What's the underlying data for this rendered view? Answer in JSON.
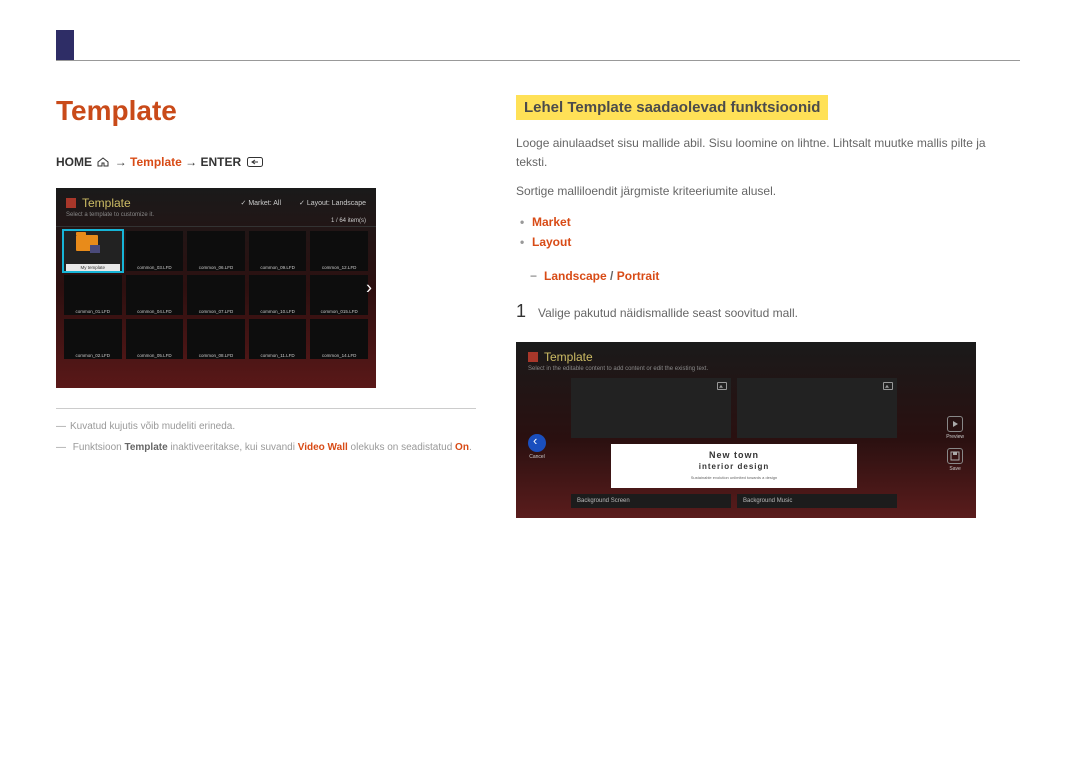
{
  "title": "Template",
  "breadcrumb": {
    "home": "HOME",
    "arrow": "→",
    "template": "Template",
    "enter": "ENTER"
  },
  "screenshot1": {
    "title": "Template",
    "subtitle": "Select a template to customize it.",
    "dropdowns": {
      "market": "Market: All",
      "layout": "Layout: Landscape"
    },
    "count": "1 / 64 item(s)",
    "mytemplate": "My template",
    "items": [
      "",
      "common_03.LFD",
      "common_06.LFD",
      "common_09.LFD",
      "common_12.LFD",
      "common_01.LFD",
      "common_04.LFD",
      "common_07.LFD",
      "common_10.LFD",
      "common_015.LFD",
      "common_02.LFD",
      "common_05.LFD",
      "common_08.LFD",
      "common_11.LFD",
      "common_14.LFD"
    ]
  },
  "notes": {
    "n1_pre": "Kuvatud kujutis võib mudeliti erineda.",
    "n2_a": "Funktsioon",
    "n2_b": "Template",
    "n2_c": "inaktiveeritakse, kui suvandi",
    "n2_d": "Video Wall",
    "n2_e": "olekuks on seadistatud",
    "n2_f": "On",
    "n2_g": "."
  },
  "right": {
    "heading": "Lehel Template saadaolevad funktsioonid",
    "p1": "Looge ainulaadset sisu mallide abil. Sisu loomine on lihtne. Lihtsalt muutke mallis pilte ja teksti.",
    "p2": "Sortige malliloendit järgmiste kriteeriumite alusel.",
    "b1": "Market",
    "b2": "Layout",
    "sub1a": "Landscape",
    "sub1sep": "/",
    "sub1b": "Portrait",
    "step1": "Valige pakutud näidismallide seast soovitud mall."
  },
  "screenshot2": {
    "title": "Template",
    "subtitle": "Select in the editable content to add content or edit the existing text.",
    "cancel": "Cancel",
    "preview": "Preview",
    "save": "Save",
    "card_l1": "New town",
    "card_l2": "interior design",
    "card_l3": "Sustainable evolution unlimited towards a design",
    "btn1": "Background Screen",
    "btn2": "Background Music"
  }
}
